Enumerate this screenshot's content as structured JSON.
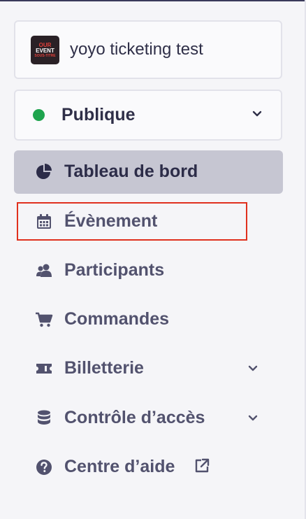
{
  "event": {
    "name": "yoyo ticketing test",
    "logo_text": [
      "OUR",
      "EVENT",
      "SOUS-TITRE"
    ]
  },
  "status": {
    "label": "Publique",
    "color": "#1fa44e"
  },
  "nav": {
    "items": [
      {
        "label": "Tableau de bord",
        "icon": "pie-chart-icon",
        "active": true
      },
      {
        "label": "Évènement",
        "icon": "calendar-icon",
        "highlighted": true
      },
      {
        "label": "Participants",
        "icon": "users-icon"
      },
      {
        "label": "Commandes",
        "icon": "cart-icon"
      },
      {
        "label": "Billetterie",
        "icon": "ticket-icon",
        "expandable": true
      },
      {
        "label": "Contrôle d’accès",
        "icon": "database-icon",
        "expandable": true
      },
      {
        "label": "Centre d’aide",
        "icon": "help-icon",
        "external": true
      }
    ]
  },
  "colors": {
    "active_bg": "#c6c6d2",
    "highlight_border": "#e0301e",
    "text": "#52526e"
  }
}
